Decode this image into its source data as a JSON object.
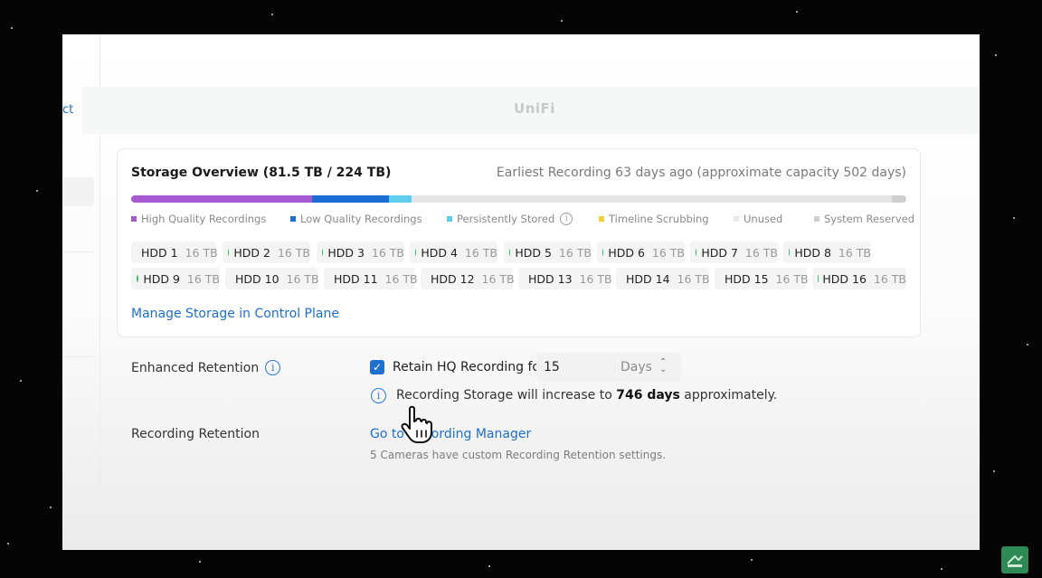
{
  "nav": {
    "left_link_fragment": "ct"
  },
  "header": {
    "brand": "UniFi"
  },
  "storage": {
    "title": "Storage Overview (81.5 TB / 224 TB)",
    "earliest": "Earliest Recording 63 days ago (approximate capacity 502 days)",
    "segments": [
      {
        "name": "High Quality Recordings",
        "color": "#a55ad2"
      },
      {
        "name": "Low Quality Recordings",
        "color": "#1b6fd4"
      },
      {
        "name": "Persistently Stored",
        "color": "#5fcdee"
      },
      {
        "name": "Timeline Scrubbing",
        "color": "#f2cf3c"
      },
      {
        "name": "Unused",
        "color": "#e6e6e6"
      },
      {
        "name": "System Reserved",
        "color": "#cfcfcf"
      }
    ],
    "drives": [
      {
        "name": "HDD 1",
        "cap": "16 TB"
      },
      {
        "name": "HDD 2",
        "cap": "16 TB"
      },
      {
        "name": "HDD 3",
        "cap": "16 TB"
      },
      {
        "name": "HDD 4",
        "cap": "16 TB"
      },
      {
        "name": "HDD 5",
        "cap": "16 TB"
      },
      {
        "name": "HDD 6",
        "cap": "16 TB"
      },
      {
        "name": "HDD 7",
        "cap": "16 TB"
      },
      {
        "name": "HDD 8",
        "cap": "16 TB"
      },
      {
        "name": "HDD 9",
        "cap": "16 TB"
      },
      {
        "name": "HDD 10",
        "cap": "16 TB"
      },
      {
        "name": "HDD 11",
        "cap": "16 TB"
      },
      {
        "name": "HDD 12",
        "cap": "16 TB"
      },
      {
        "name": "HDD 13",
        "cap": "16 TB"
      },
      {
        "name": "HDD 14",
        "cap": "16 TB"
      },
      {
        "name": "HDD 15",
        "cap": "16 TB"
      },
      {
        "name": "HDD 16",
        "cap": "16 TB"
      }
    ],
    "drive_status_color": "#3cc36f",
    "manage_link": "Manage Storage in Control Plane"
  },
  "enhanced": {
    "label": "Enhanced Retention",
    "checkbox_label": "Retain HQ Recording for",
    "checked": true,
    "value": "15",
    "unit": "Days",
    "note_prefix": "Recording Storage will increase to",
    "note_value": "746 days",
    "note_suffix": "approximately."
  },
  "retention": {
    "label": "Recording Retention",
    "link": "Go to Recording Manager",
    "note": "5 Cameras have custom Recording Retention settings."
  },
  "accent_color": "#1f6fc9"
}
